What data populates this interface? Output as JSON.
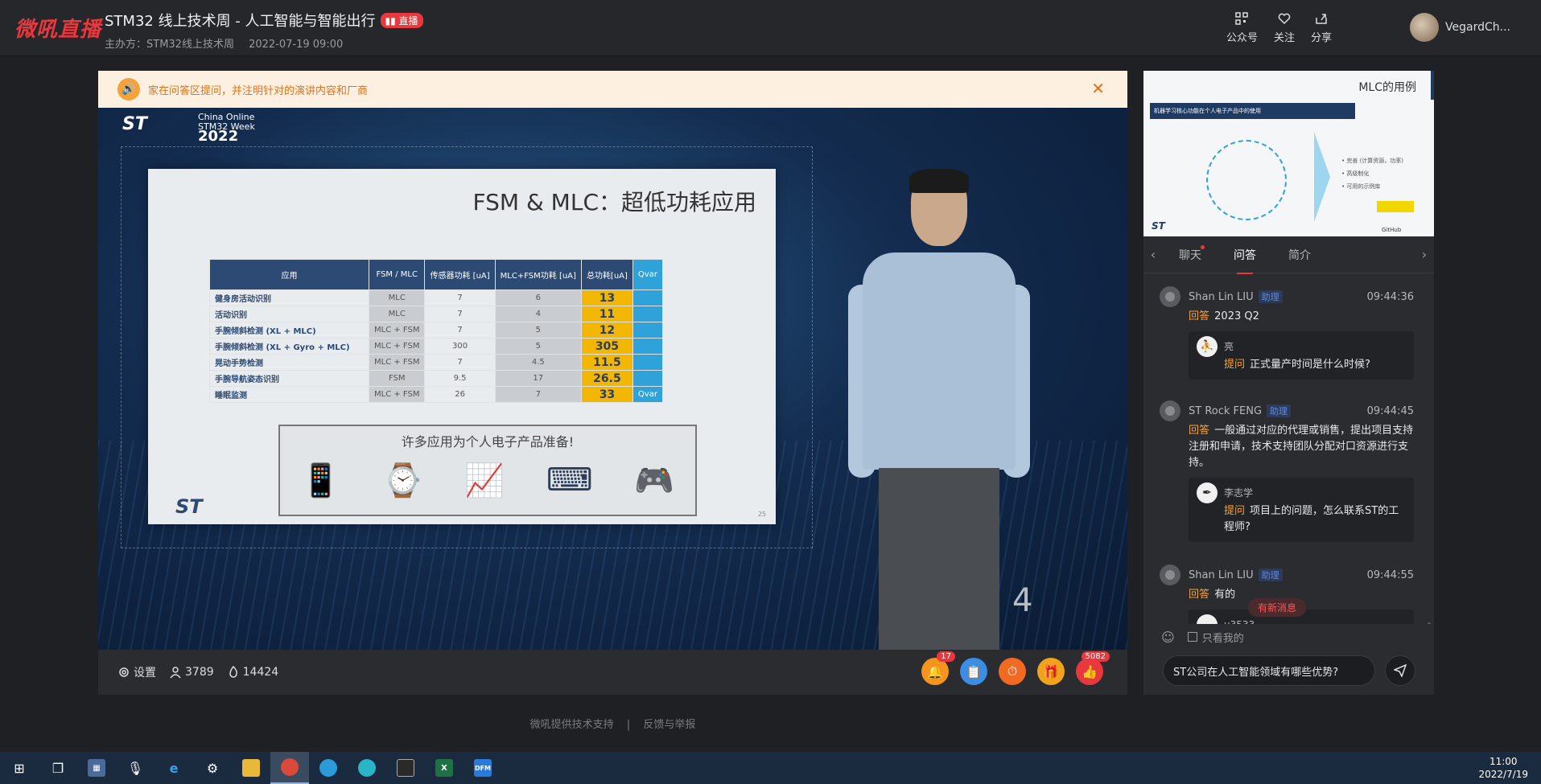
{
  "header": {
    "logo": "微吼直播",
    "title": "STM32 线上技术周 - 人工智能与智能出行",
    "live_badge": "直播",
    "host": "主办方：STM32线上技术周",
    "date": "2022-07-19 09:00",
    "actions": [
      {
        "label": "公众号",
        "icon": "qrcode-icon"
      },
      {
        "label": "关注",
        "icon": "heart-icon"
      },
      {
        "label": "分享",
        "icon": "share-icon"
      }
    ],
    "username": "VegardCh..."
  },
  "notice": {
    "text": "家在问答区提问，并注明针对的演讲内容和厂商"
  },
  "video": {
    "st_logo": "ST",
    "event_line1": "China Online",
    "event_line2": "STM32 Week",
    "event_year": "2022",
    "slide": {
      "title": "FSM & MLC：超低功耗应用",
      "headers": [
        "应用",
        "FSM / MLC",
        "传感器功耗 [uA]",
        "MLC+FSM功耗 [uA]",
        "总功耗[uA]",
        "Qvar"
      ],
      "rows": [
        {
          "app": "健身房活动识别",
          "mode": "MLC",
          "sensor": "7",
          "mlc": "6",
          "total": "13",
          "extra": ""
        },
        {
          "app": "活动识别",
          "mode": "MLC",
          "sensor": "7",
          "mlc": "4",
          "total": "11",
          "extra": ""
        },
        {
          "app": "手腕倾斜检测 (XL + MLC)",
          "mode": "MLC + FSM",
          "sensor": "7",
          "mlc": "5",
          "total": "12",
          "extra": ""
        },
        {
          "app": "手腕倾斜检测 (XL + Gyro + MLC)",
          "mode": "MLC + FSM",
          "sensor": "300",
          "mlc": "5",
          "total": "305",
          "extra": ""
        },
        {
          "app": "晃动手势检测",
          "mode": "MLC + FSM",
          "sensor": "7",
          "mlc": "4.5",
          "total": "11.5",
          "extra": ""
        },
        {
          "app": "手腕导航姿态识别",
          "mode": "FSM",
          "sensor": "9.5",
          "mlc": "17",
          "total": "26.5",
          "extra": ""
        },
        {
          "app": "睡眠监测",
          "mode": "MLC + FSM",
          "sensor": "26",
          "mlc": "7",
          "total": "33",
          "extra": "Qvar"
        }
      ],
      "box_title": "许多应用为个人电子产品准备!",
      "devices": [
        "📱",
        "⌚",
        "📈",
        "⌨",
        "🎮"
      ],
      "st_logo": "ST",
      "page_num": "25"
    },
    "corner_number": "4"
  },
  "controls": {
    "settings_label": "设置",
    "viewers": "3789",
    "likes": "14424",
    "actions": [
      {
        "name": "bell",
        "glyph": "🔔",
        "badge": "17"
      },
      {
        "name": "clip",
        "glyph": "📋",
        "badge": ""
      },
      {
        "name": "timer",
        "glyph": "⏱",
        "badge": ""
      },
      {
        "name": "gift",
        "glyph": "🎁",
        "badge": ""
      },
      {
        "name": "like",
        "glyph": "👍",
        "badge": "5082"
      }
    ]
  },
  "footer": {
    "support": "微吼提供技术支持",
    "separator": "|",
    "report": "反馈与举报"
  },
  "side": {
    "pip": {
      "title": "MLC的用例",
      "bar": "机器学习核心功能在个人电子产品中的使用",
      "list": [
        "• 完善 (计算资源，功率)",
        "• 高级制化",
        "• 可用的示例库"
      ],
      "st_logo": "ST",
      "github": "GitHub"
    },
    "tabs": [
      "聊天",
      "问答",
      "简介"
    ],
    "qa": [
      {
        "name": "Shan Lin LIU",
        "role": "助理",
        "time": "09:44:36",
        "answer_tag": "回答",
        "answer": "2023 Q2",
        "q_user": "亮",
        "q_tag": "提问",
        "question": "正式量产时间是什么时候?"
      },
      {
        "name": "ST Rock FENG",
        "role": "助理",
        "time": "09:44:45",
        "answer_tag": "回答",
        "answer": "一般通过对应的代理或销售，提出项目支持注册和申请，技术支持团队分配对口资源进行支持。",
        "q_user": "李志学",
        "q_tag": "提问",
        "question": "项目上的问题，怎么联系ST的工程师?"
      },
      {
        "name": "Shan Lin LIU",
        "role": "助理",
        "time": "09:44:55",
        "answer_tag": "回答",
        "answer": "有的",
        "q_user": "u3533",
        "q_tag": "",
        "question": ""
      }
    ],
    "new_message": "有新消息",
    "only_mine": "只看我的",
    "input_value": "ST公司在人工智能领域有哪些优势?"
  },
  "taskbar": {
    "time": "11:00",
    "date": "2022/7/19"
  }
}
